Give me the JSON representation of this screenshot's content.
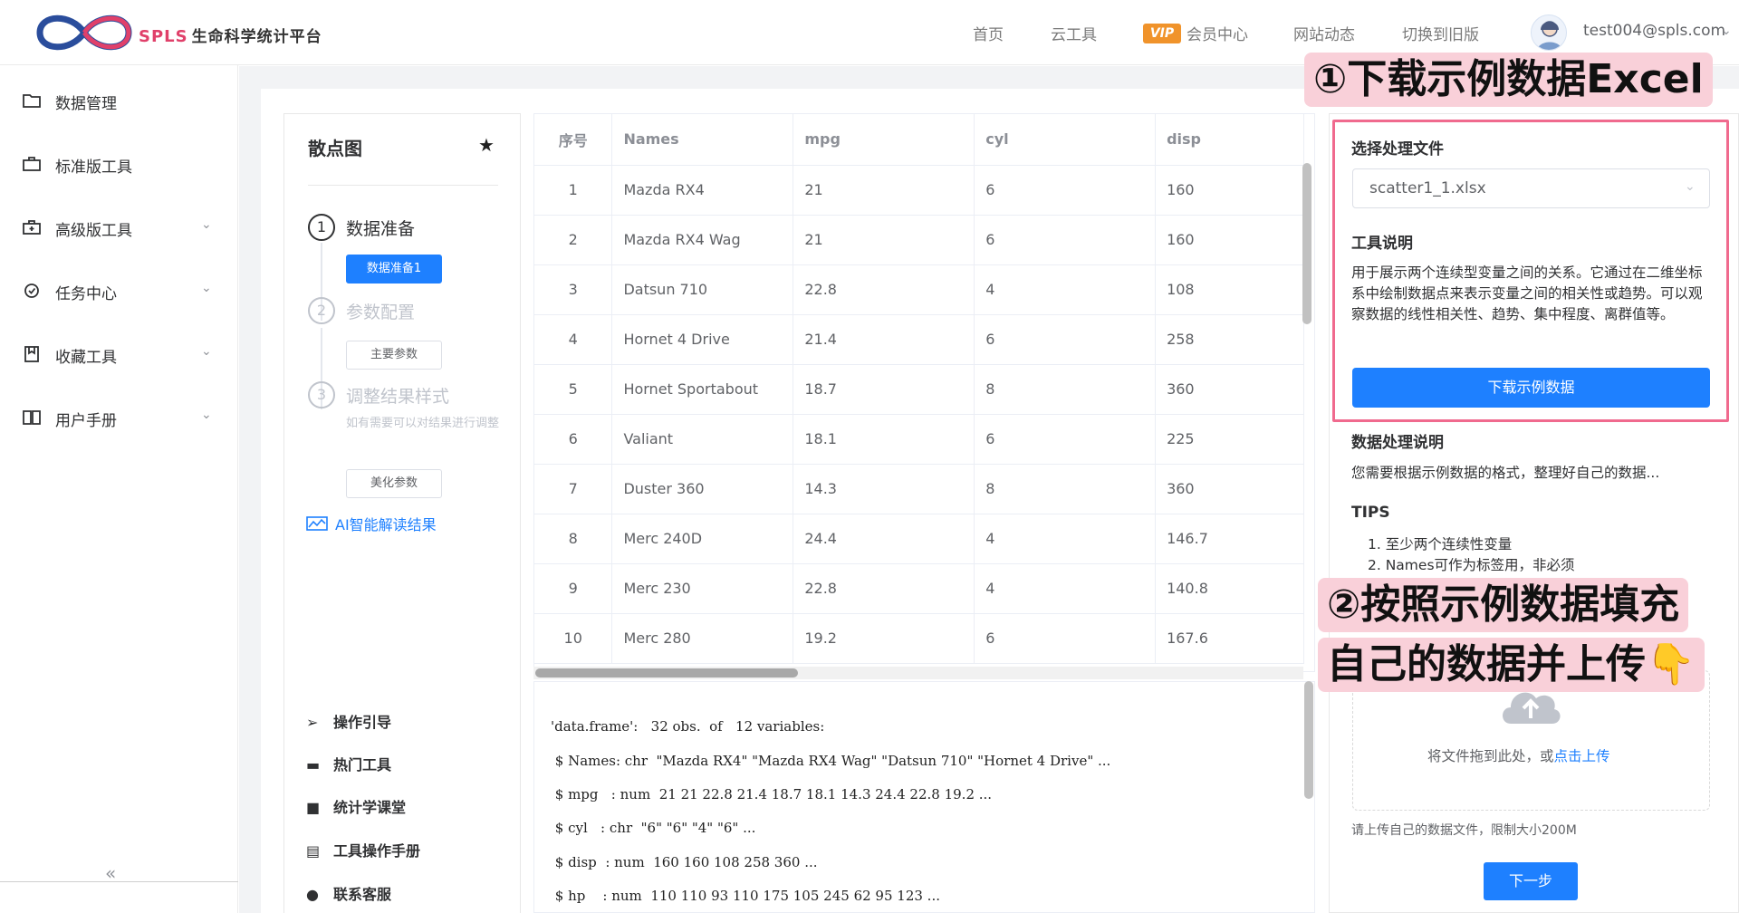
{
  "header": {
    "brand": "SPLS",
    "brand_cn": "生命科学统计平台",
    "nav": [
      "首页",
      "云工具",
      "会员中心",
      "网站动态",
      "切换到旧版"
    ],
    "vip_badge": "VIP",
    "user_email": "test004@spls.com"
  },
  "sidebar": {
    "items": [
      {
        "label": "数据管理",
        "icon": "folder-icon",
        "has_chevron": false
      },
      {
        "label": "标准版工具",
        "icon": "toolbox-icon",
        "has_chevron": false
      },
      {
        "label": "高级版工具",
        "icon": "toolbox-plus-icon",
        "has_chevron": true
      },
      {
        "label": "任务中心",
        "icon": "task-icon",
        "has_chevron": true
      },
      {
        "label": "收藏工具",
        "icon": "bookmark-icon",
        "has_chevron": true
      },
      {
        "label": "用户手册",
        "icon": "book-icon",
        "has_chevron": true
      }
    ],
    "collapse_icon": "«"
  },
  "steps": {
    "title": "散点图",
    "step1": {
      "num": "1",
      "label": "数据准备",
      "button": "数据准备1"
    },
    "step2": {
      "num": "2",
      "label": "参数配置",
      "button": "主要参数"
    },
    "step3": {
      "num": "3",
      "label": "调整结果样式",
      "desc": "如有需要可以对结果进行调整",
      "button": "美化参数"
    },
    "ai_link": "AI智能解读结果",
    "bottom_links": [
      "操作引导",
      "热门工具",
      "统计学课堂",
      "工具操作手册",
      "联系客服"
    ]
  },
  "table": {
    "headers": [
      "序号",
      "Names",
      "mpg",
      "cyl",
      "disp"
    ],
    "rows": [
      [
        "1",
        "Mazda RX4",
        "21",
        "6",
        "160"
      ],
      [
        "2",
        "Mazda RX4 Wag",
        "21",
        "6",
        "160"
      ],
      [
        "3",
        "Datsun 710",
        "22.8",
        "4",
        "108"
      ],
      [
        "4",
        "Hornet 4 Drive",
        "21.4",
        "6",
        "258"
      ],
      [
        "5",
        "Hornet Sportabout",
        "18.7",
        "8",
        "360"
      ],
      [
        "6",
        "Valiant",
        "18.1",
        "6",
        "225"
      ],
      [
        "7",
        "Duster 360",
        "14.3",
        "8",
        "360"
      ],
      [
        "8",
        "Merc 240D",
        "24.4",
        "4",
        "146.7"
      ],
      [
        "9",
        "Merc 230",
        "22.8",
        "4",
        "140.8"
      ],
      [
        "10",
        "Merc 280",
        "19.2",
        "6",
        "167.6"
      ]
    ]
  },
  "console": {
    "lines": [
      "'data.frame':   32 obs.  of   12 variables:",
      " $ Names: chr  \"Mazda RX4\" \"Mazda RX4 Wag\" \"Datsun 710\" \"Hornet 4 Drive\" ...",
      " $ mpg   : num  21 21 22.8 21.4 18.7 18.1 14.3 24.4 22.8 19.2 ...",
      " $ cyl   : chr  \"6\" \"6\" \"4\" \"6\" ...",
      " $ disp  : num  160 160 108 258 360 ...",
      " $ hp    : num  110 110 93 110 175 105 245 62 95 123 ..."
    ]
  },
  "right_panel": {
    "select_label": "选择处理文件",
    "selected_file": "scatter1_1.xlsx",
    "tool_desc_title": "工具说明",
    "tool_desc": "用于展示两个连续型变量之间的关系。它通过在二维坐标系中绘制数据点来表示变量之间的相关性或趋势。可以观察数据的线性相关性、趋势、集中程度、离群值等。",
    "download_button": "下载示例数据",
    "proc_title": "数据处理说明",
    "proc_desc": "您需要根据示例数据的格式，整理好自己的数据...",
    "tips_title": "TIPS",
    "tips": [
      "1. 至少两个连续性变量",
      "2. Names可作为标签用，非必须"
    ],
    "upload_text": "将文件拖到此处，或",
    "upload_link": "点击上传",
    "upload_hint": "请上传自己的数据文件，限制大小200M",
    "next_button": "下一步"
  },
  "annotations": {
    "a1": "①下载示例数据Excel",
    "a2": "②按照示例数据填充",
    "a3": "自己的数据并上传👇"
  },
  "colors": {
    "primary": "#1e80ff",
    "highlight": "#f06a8e",
    "annotation_bg": "#f9d0d9",
    "brand": "#e0406a"
  }
}
